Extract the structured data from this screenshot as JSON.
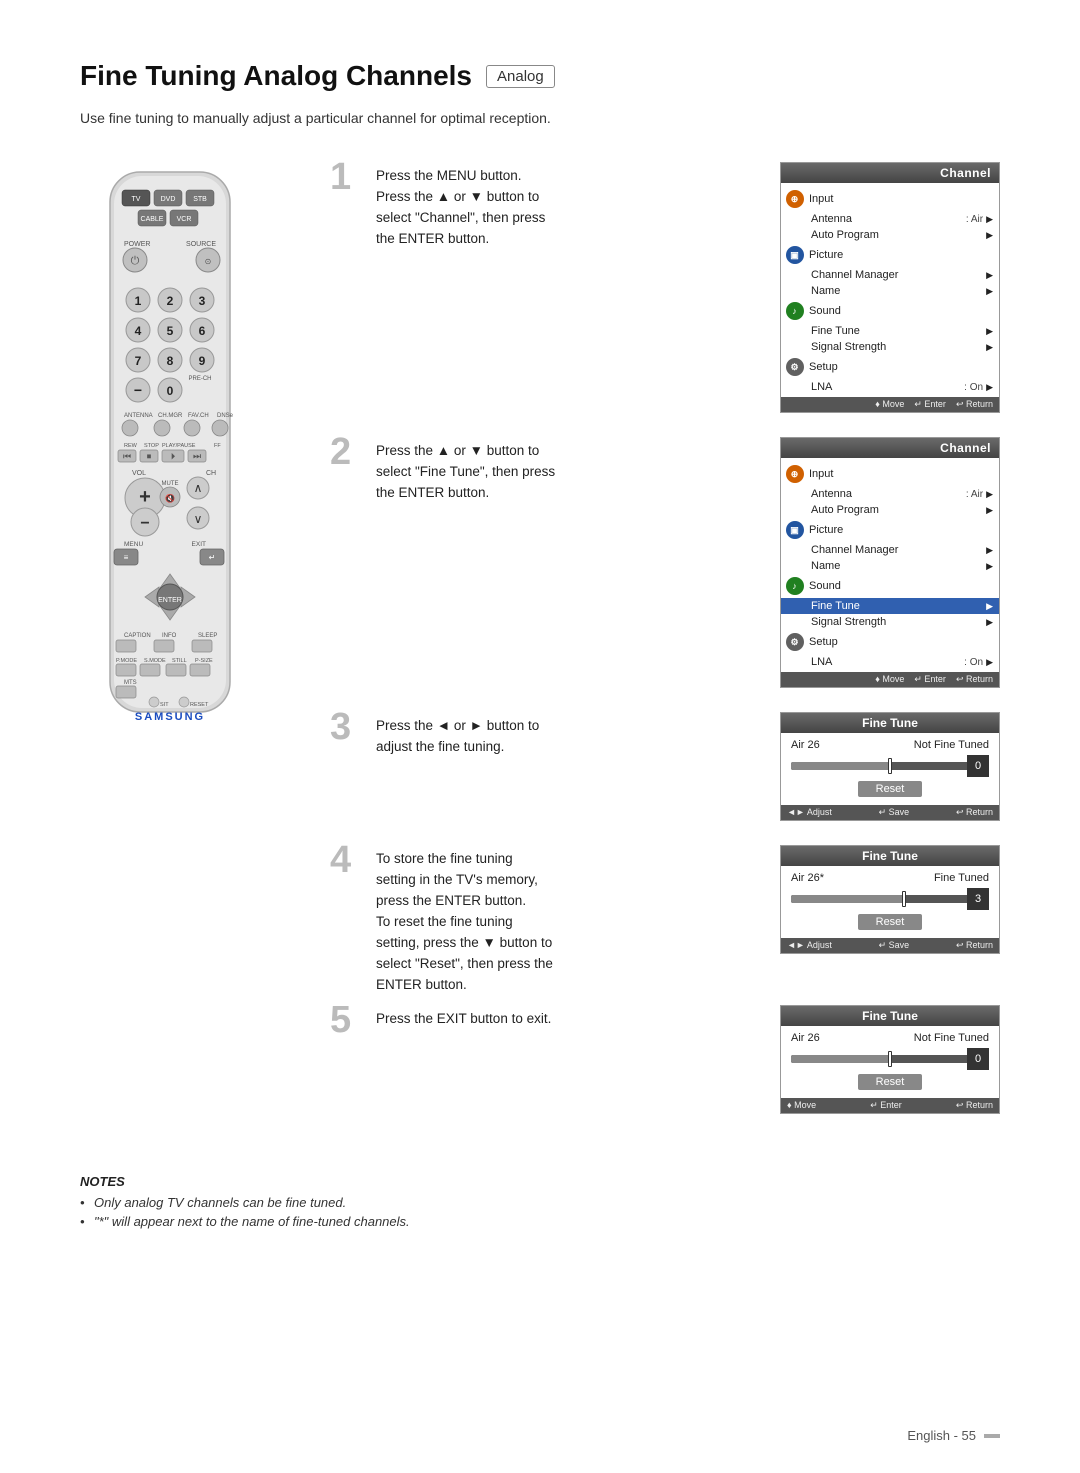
{
  "page": {
    "title": "Fine Tuning Analog Channels",
    "badge": "Analog",
    "subtitle": "Use fine tuning to manually adjust a particular channel for optimal reception.",
    "page_number": "English - 55"
  },
  "steps": [
    {
      "number": "1",
      "text": "Press the MENU button.\nPress the ▲ or ▼ button to\nselect \"Channel\", then press\nthe ENTER button.",
      "screen_type": "channel_menu",
      "screen_highlight": "none"
    },
    {
      "number": "2",
      "text": "Press the ▲ or ▼ button to\nselect \"Fine Tune\", then press\nthe ENTER button.",
      "screen_type": "channel_menu",
      "screen_highlight": "finetune"
    },
    {
      "number": "3",
      "text": "Press the ◄ or ► button to\nadjust the fine tuning.",
      "screen_type": "fine_tune",
      "fine_tune_label": "Air 26",
      "fine_tune_status": "Not Fine Tuned",
      "fine_tune_value": "0",
      "fine_tune_tuned": false
    },
    {
      "number": "4",
      "text": "To store the fine tuning\nsetting in the TV's memory,\npress the ENTER button.\nTo reset the fine tuning\nsetting, press the ▼ button to\nselect \"Reset\", then press the\nENTER button.",
      "screen_type": "fine_tune",
      "fine_tune_label": "Air 26*",
      "fine_tune_status": "Fine Tuned",
      "fine_tune_value": "3",
      "fine_tune_tuned": true
    },
    {
      "number": "5",
      "text": "Press the EXIT button to exit.",
      "screen_type": "fine_tune_exit",
      "fine_tune_label": "Air 26",
      "fine_tune_status": "Not Fine Tuned",
      "fine_tune_value": "0",
      "fine_tune_tuned": false
    }
  ],
  "channel_menu": {
    "header": "Channel",
    "items": [
      {
        "icon": "input",
        "label": "Input",
        "value": "",
        "sub_items": [
          {
            "label": "Antenna",
            "value": ": Air",
            "arrow": true
          }
        ]
      },
      {
        "icon": "none",
        "label": "Auto Program",
        "value": "",
        "arrow": true
      },
      {
        "icon": "picture",
        "label": "Picture",
        "sub_items": [
          {
            "label": "Channel Manager",
            "value": "",
            "arrow": true
          }
        ]
      },
      {
        "icon": "none",
        "label": "Name",
        "value": "",
        "arrow": true
      },
      {
        "icon": "sound",
        "label": "Sound",
        "sub_items": [
          {
            "label": "Fine Tune",
            "value": "",
            "arrow": true
          }
        ]
      },
      {
        "icon": "none",
        "label": "Signal Strength",
        "value": "",
        "arrow": true
      },
      {
        "icon": "setup",
        "label": "Setup",
        "sub_items": [
          {
            "label": "LNA",
            "value": ": On",
            "arrow": true
          }
        ]
      }
    ],
    "footer": [
      "♦ Move",
      "↵ Enter",
      "↩ Return"
    ]
  },
  "fine_tune": {
    "header": "Fine Tune",
    "reset_label": "Reset",
    "footer": [
      "◄► Adjust",
      "↵ Save",
      "↩ Return"
    ],
    "footer_exit": [
      "♦ Move",
      "↵ Enter",
      "↩ Return"
    ]
  },
  "notes": {
    "title": "NOTES",
    "items": [
      "Only analog TV channels can be fine tuned.",
      "\"*\" will appear next to the name of fine-tuned channels."
    ]
  }
}
